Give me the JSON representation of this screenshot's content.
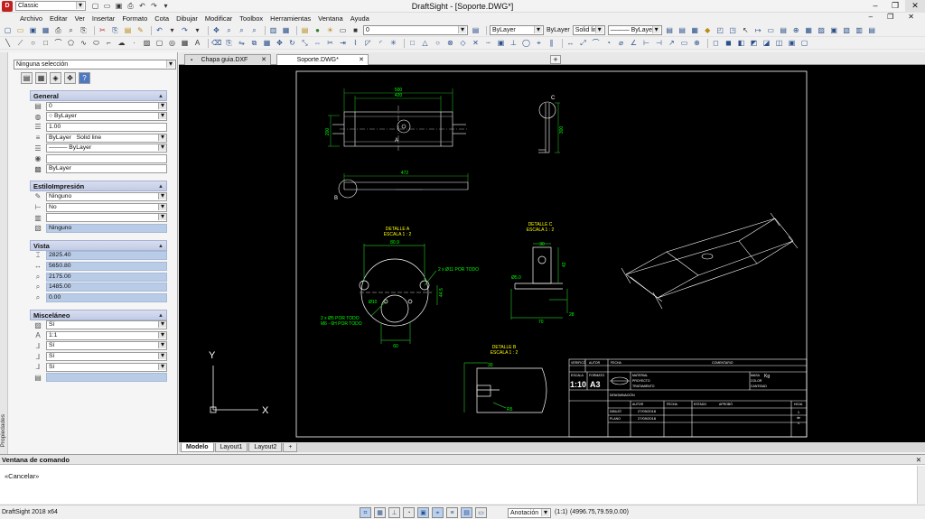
{
  "titlebar": {
    "title": "DraftSight - [Soporte.DWG*]",
    "workspace": "Classic",
    "minimize": "–",
    "restore": "❐",
    "close": "✕"
  },
  "menubar": {
    "items": [
      "Archivo",
      "Editar",
      "Ver",
      "Insertar",
      "Formato",
      "Cota",
      "Dibujar",
      "Modificar",
      "Toolbox",
      "Herramientas",
      "Ventana",
      "Ayuda"
    ],
    "doc_minimize": "–",
    "doc_restore": "❐",
    "doc_close": "✕"
  },
  "layers": {
    "layer_combo": "0",
    "color_combo": "ByLayer",
    "linestyle_label": "ByLayer",
    "linestyle_combo": "Solid line",
    "lineweight_combo": "——— ByLayer"
  },
  "properties": {
    "palette_label": "Propiedades",
    "selection": "Ninguna selección",
    "general": {
      "title": "General",
      "layer": "0",
      "color": "ByLayer",
      "scale": "1.00",
      "linestyle_scope": "ByLayer",
      "linestyle": "Solid line",
      "lineweight": "——— ByLayer",
      "blank": "",
      "transparency": "ByLayer"
    },
    "print_style": {
      "title": "EstiloImpresión",
      "style": "Ninguno",
      "flag": "No",
      "blank": "",
      "table": "Ninguno"
    },
    "view": {
      "title": "Vista",
      "values": [
        "2825.40",
        "5650.80",
        "2175.00",
        "1485.00",
        "0.00"
      ]
    },
    "misc": {
      "title": "Misceláneo",
      "values": [
        "Sí",
        "1:1",
        "Sí",
        "Sí",
        "Sí",
        ""
      ]
    }
  },
  "doc_tabs": {
    "tab1": "Chapa guia.DXF",
    "tab2": "Soporte.DWG*",
    "close": "✕",
    "new": "+"
  },
  "sheet_tabs": [
    "Modelo",
    "Layout1",
    "Layout2",
    "+"
  ],
  "drawing": {
    "top_dims": [
      "500",
      "420"
    ],
    "top_side_dim": "200",
    "point_a": "A",
    "point_c": "C",
    "c_dim": "300",
    "point_b": "B",
    "mid_dim": "472",
    "detail_a_title": [
      "DETALLE A",
      "ESCALA 1 : 2"
    ],
    "detail_a_dims": [
      "80.9",
      "2 x Ø11 POR TODO",
      "Ø10",
      "44.5",
      "60"
    ],
    "detail_a_holes": [
      "2 x Ø5 POR TODO",
      "M6 - 6H POR TODO"
    ],
    "detail_c_title": [
      "DETALLE C",
      "ESCALA 1 : 2"
    ],
    "detail_c_dims": [
      "30",
      "Ø5.0",
      "42",
      "70",
      "28"
    ],
    "detail_b_title": [
      "DETALLE B",
      "ESCALA 1 : 2"
    ],
    "detail_b_dims": [
      "30",
      "R5"
    ],
    "axis_y": "Y",
    "axis_x": "X",
    "tblock": {
      "headers": [
        "VERIFICÓ",
        "AUTOR",
        "FECHA",
        "COMENTARIO"
      ],
      "escala_label": "ESCALA",
      "formato_label": "FORMATO",
      "scale": "1:10",
      "format": "A3",
      "material_label": "MATERIAL",
      "proyecto_label": "PROYECTO",
      "tratamiento_label": "TRATAMIENTO",
      "masa_label": "MASA",
      "masa_value": "Kg",
      "color_label": "COLOR",
      "cantidad_label": "CANTIDAD",
      "denominacion_label": "DENOMINACIÓN",
      "row_headers": [
        "AUTOR",
        "FECHA",
        "ESTADO",
        "APROBÓ",
        "HOJA"
      ],
      "dibujo_label": "DIBUJÓ",
      "dibujo_date": "27/09/2018",
      "plano_label": "PLANO",
      "plano_date": "27/09/2018",
      "sheet": [
        "1",
        "de",
        "1"
      ]
    }
  },
  "command": {
    "title": "Ventana de comando",
    "close": "✕",
    "line": "«Cancelar»"
  },
  "status": {
    "app": "DraftSight 2018 x64",
    "annotation": "Anotación",
    "scale": "(1:1)",
    "coords": "(4996.75,79.59,0.00)"
  }
}
